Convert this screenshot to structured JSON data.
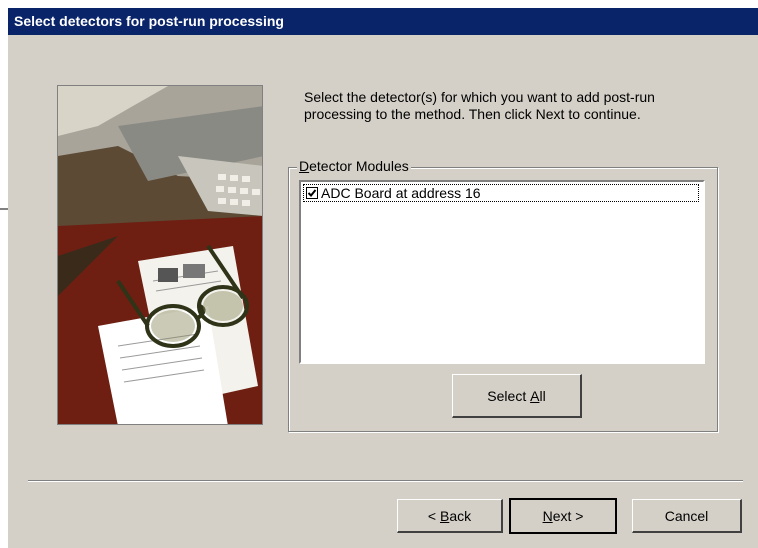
{
  "dialog": {
    "title": "Select detectors for post-run processing",
    "instructions": "Select the detector(s) for which you want to add post-run processing to the method. Then click Next to continue.",
    "group": {
      "label_underlined": "D",
      "label_rest": "etector Modules",
      "items": [
        {
          "label": "ADC Board at address 16",
          "checked": true
        }
      ]
    },
    "buttons": {
      "select_all": {
        "pre": "Select ",
        "ul": "A",
        "post": "ll"
      },
      "back": {
        "pre": "< ",
        "ul": "B",
        "post": "ack"
      },
      "next": {
        "pre": "",
        "ul": "N",
        "post": "ext >"
      },
      "cancel": "Cancel"
    }
  }
}
